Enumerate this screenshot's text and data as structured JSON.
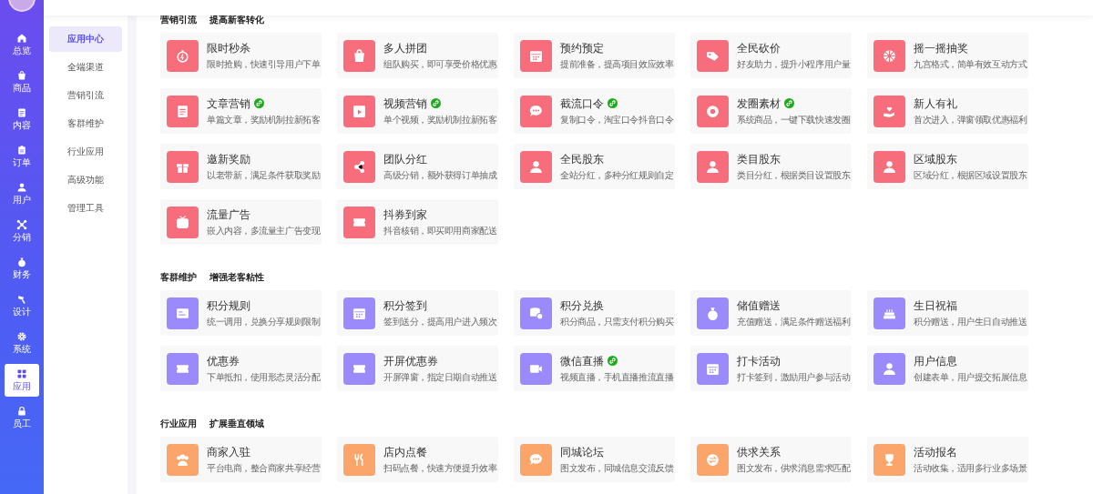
{
  "sidebar": {
    "items": [
      {
        "label": "总览",
        "selected": false
      },
      {
        "label": "商品",
        "selected": false
      },
      {
        "label": "内容",
        "selected": false
      },
      {
        "label": "订单",
        "selected": false
      },
      {
        "label": "用户",
        "selected": false
      },
      {
        "label": "分销",
        "selected": false
      },
      {
        "label": "财务",
        "selected": false
      },
      {
        "label": "设计",
        "selected": false
      },
      {
        "label": "系统",
        "selected": false
      },
      {
        "label": "应用",
        "selected": true
      },
      {
        "label": "员工",
        "selected": false
      }
    ]
  },
  "subnav": {
    "items": [
      {
        "label": "应用中心",
        "selected": true
      },
      {
        "label": "全端渠道",
        "selected": false
      },
      {
        "label": "营销引流",
        "selected": false
      },
      {
        "label": "客群维护",
        "selected": false
      },
      {
        "label": "行业应用",
        "selected": false
      },
      {
        "label": "高级功能",
        "selected": false
      },
      {
        "label": "管理工具",
        "selected": false
      }
    ]
  },
  "sections": [
    {
      "title": "营销引流",
      "subtitle": "提高新客转化",
      "color": "#f76d7b",
      "cards": [
        {
          "title": "限时秒杀",
          "description": "限时抢购，快速引导用户下单",
          "linked": false
        },
        {
          "title": "多人拼团",
          "description": "组队购买，即可享受价格优惠",
          "linked": false
        },
        {
          "title": "预约预定",
          "description": "提前准备，提高项目效应效率",
          "linked": false
        },
        {
          "title": "全民砍价",
          "description": "好友助力，提升小程序用户量",
          "linked": false
        },
        {
          "title": "摇一摇抽奖",
          "description": "九宫格式，简单有效互动方式",
          "linked": false
        },
        {
          "title": "文章营销",
          "description": "单篇文章，奖励机制拉新拓客",
          "linked": true
        },
        {
          "title": "视频营销",
          "description": "单个视频，奖励机制拉新拓客",
          "linked": true
        },
        {
          "title": "截流口令",
          "description": "复制口令，淘宝口令抖音口令",
          "linked": true
        },
        {
          "title": "发圈素材",
          "description": "系统商品，一键下载快速发圈",
          "linked": true
        },
        {
          "title": "新人有礼",
          "description": "首次进入，弹窗领取优惠福利",
          "linked": false
        },
        {
          "title": "邀新奖励",
          "description": "以老带新，满足条件获取奖励",
          "linked": false
        },
        {
          "title": "团队分红",
          "description": "高级分销，额外获得订单抽成",
          "linked": false
        },
        {
          "title": "全民股东",
          "description": "全站分红，多种分红规则自定",
          "linked": false
        },
        {
          "title": "类目股东",
          "description": "类目分红，根据类目设置股东",
          "linked": false
        },
        {
          "title": "区域股东",
          "description": "区域分红，根据区域设置股东",
          "linked": false
        },
        {
          "title": "流量广告",
          "description": "嵌入内容，多流量主广告变现",
          "linked": false
        },
        {
          "title": "抖券到家",
          "description": "抖音核销，即买即用商家配送",
          "linked": false
        }
      ]
    },
    {
      "title": "客群维护",
      "subtitle": "增强老客粘性",
      "color": "#9b8afb",
      "cards": [
        {
          "title": "积分规则",
          "description": "统一调用，兑换分享规则限制",
          "linked": false
        },
        {
          "title": "积分签到",
          "description": "签到送分，提高用户进入频次",
          "linked": false
        },
        {
          "title": "积分兑换",
          "description": "积分商品，只需支付积分购买",
          "linked": false
        },
        {
          "title": "储值赠送",
          "description": "充值赠送，满足条件赠送福利",
          "linked": false
        },
        {
          "title": "生日祝福",
          "description": "积分赠送，用户生日自动推送",
          "linked": false
        },
        {
          "title": "优惠券",
          "description": "下单抵扣，使用形态灵活分配",
          "linked": false
        },
        {
          "title": "开屏优惠券",
          "description": "开屏弹窗，指定日期自动推送",
          "linked": false
        },
        {
          "title": "微信直播",
          "description": "视频直播，手机直播推流直播",
          "linked": true
        },
        {
          "title": "打卡活动",
          "description": "打卡签到，激励用户参与活动",
          "linked": false
        },
        {
          "title": "用户信息",
          "description": "创建表单，用户提交拓展信息",
          "linked": false
        }
      ]
    },
    {
      "title": "行业应用",
      "subtitle": "扩展垂直领域",
      "color": "#fca56b",
      "cards": [
        {
          "title": "商家入驻",
          "description": "平台电商，整合商家共享经营",
          "linked": false
        },
        {
          "title": "店内点餐",
          "description": "扫码点餐，快速方便提升效率",
          "linked": false
        },
        {
          "title": "同城论坛",
          "description": "图文发布，同城信息交流反馈",
          "linked": false
        },
        {
          "title": "供求关系",
          "description": "图文发布，供求消息需求匹配",
          "linked": false
        },
        {
          "title": "活动报名",
          "description": "活动收集，适用多行业多场景",
          "linked": false
        }
      ]
    }
  ]
}
